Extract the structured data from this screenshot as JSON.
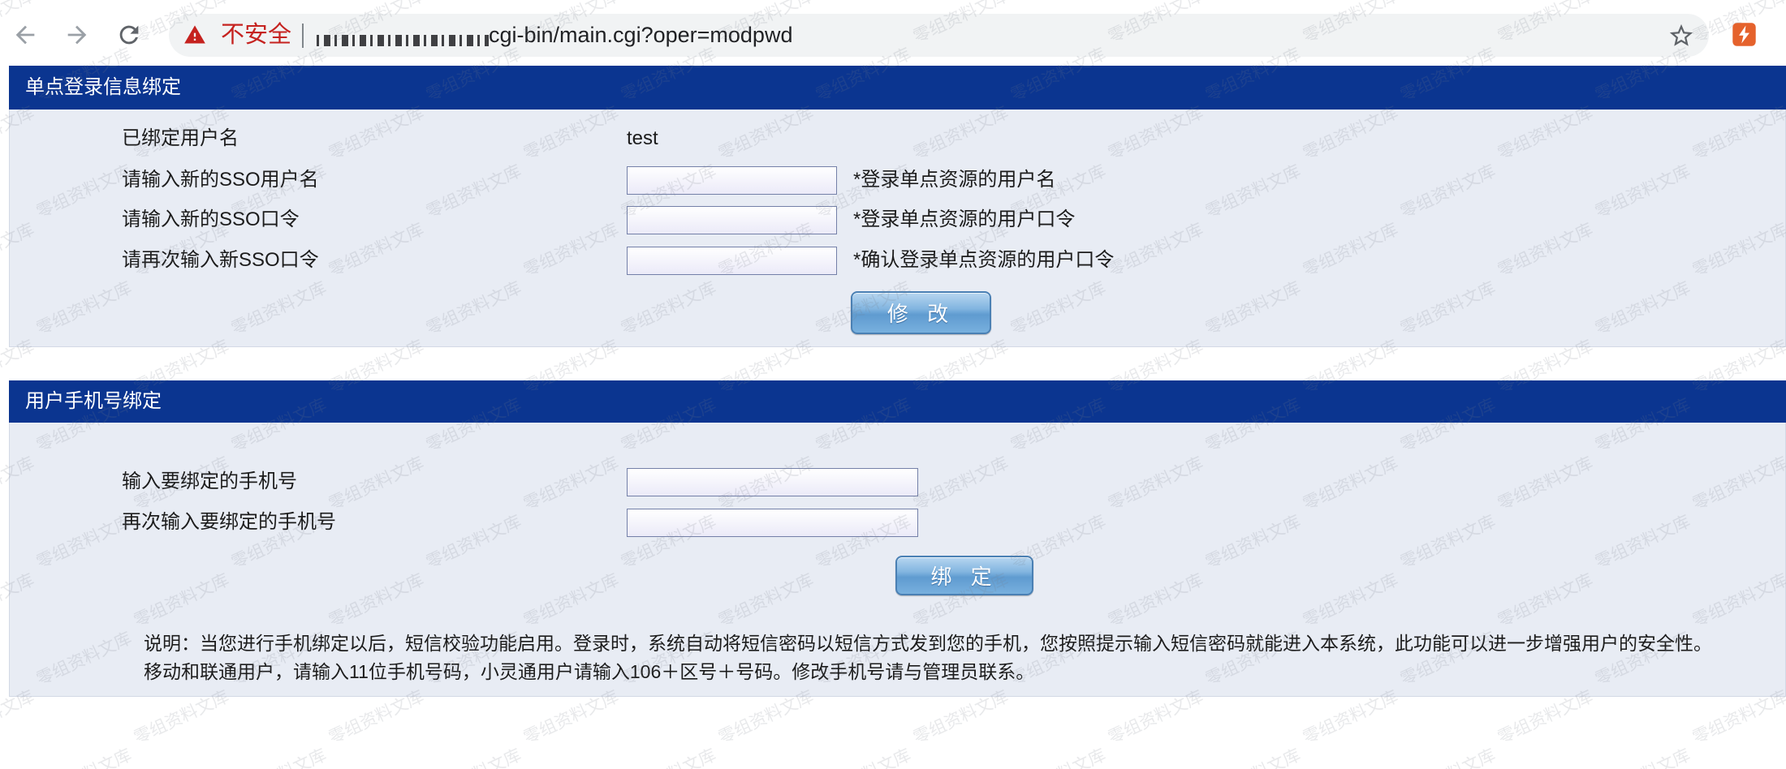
{
  "browser": {
    "icons": {
      "back": "arrow-left-icon",
      "forward": "arrow-right-icon",
      "reload": "reload-icon",
      "security": "warning-icon",
      "bookmark": "star-icon",
      "extension": "extension-icon"
    },
    "security_label": "不安全",
    "url": "cgi-bin/main.cgi?oper=modpwd"
  },
  "sso": {
    "title": "单点登录信息绑定",
    "bound_label": "已绑定用户名",
    "bound_value": "test",
    "fields": [
      {
        "label": "请输入新的SSO用户名",
        "value": "",
        "hint": "*登录单点资源的用户名"
      },
      {
        "label": "请输入新的SSO口令",
        "value": "",
        "hint": "*登录单点资源的用户口令"
      },
      {
        "label": "请再次输入新SSO口令",
        "value": "",
        "hint": "*确认登录单点资源的用户口令"
      }
    ],
    "submit_label": "修 改"
  },
  "phone": {
    "title": "用户手机号绑定",
    "fields": [
      {
        "label": "输入要绑定的手机号",
        "value": ""
      },
      {
        "label": "再次输入要绑定的手机号",
        "value": ""
      }
    ],
    "submit_label": "绑 定",
    "description": [
      "说明：当您进行手机绑定以后，短信校验功能启用。登录时，系统自动将短信密码以短信方式发到您的手机，您按照提示输入短信密码就能进入本系统，此功能可以进一步增强用户的安全性。",
      "移动和联通用户，请输入11位手机号码，小灵通用户请输入106＋区号＋号码。修改手机号请与管理员联系。"
    ]
  },
  "watermark": "零组资料文库",
  "colors": {
    "header_bg": "#0b3590",
    "section_bg": "#e8ecf4",
    "insecure_red": "#c5221f",
    "button_blue": "#5f9bd0",
    "extension_orange": "#e5622c"
  }
}
